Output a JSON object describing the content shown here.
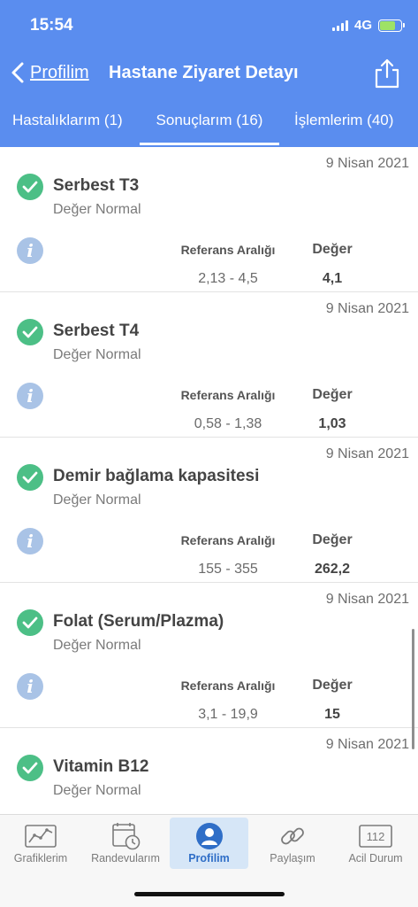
{
  "status_bar": {
    "time": "15:54",
    "network": "4G"
  },
  "nav": {
    "back_label": "Profilim",
    "title": "Hastane Ziyaret Detayı"
  },
  "tabs": [
    {
      "label": "Hastalıklarım (1)"
    },
    {
      "label": "Sonuçlarım (16)"
    },
    {
      "label": "İşlemlerim (40)"
    }
  ],
  "results": [
    {
      "date": "9 Nisan 2021",
      "name": "Serbest T3",
      "status": "Değer Normal",
      "ref_label": "Referans Aralığı",
      "ref": "2,13 - 4,5",
      "value_label": "Değer",
      "value": "4,1"
    },
    {
      "date": "9 Nisan 2021",
      "name": "Serbest T4",
      "status": "Değer Normal",
      "ref_label": "Referans Aralığı",
      "ref": "0,58 - 1,38",
      "value_label": "Değer",
      "value": "1,03"
    },
    {
      "date": "9 Nisan 2021",
      "name": "Demir bağlama kapasitesi",
      "status": "Değer Normal",
      "ref_label": "Referans Aralığı",
      "ref": "155 - 355",
      "value_label": "Değer",
      "value": "262,2"
    },
    {
      "date": "9 Nisan 2021",
      "name": "Folat (Serum/Plazma)",
      "status": "Değer Normal",
      "ref_label": "Referans Aralığı",
      "ref": "3,1 - 19,9",
      "value_label": "Değer",
      "value": "15"
    },
    {
      "date": "9 Nisan 2021",
      "name": "Vitamin B12",
      "status": "Değer Normal"
    }
  ],
  "tabbar": [
    {
      "label": "Grafiklerim",
      "icon": "chart-icon"
    },
    {
      "label": "Randevularım",
      "icon": "calendar-clock-icon"
    },
    {
      "label": "Profilim",
      "icon": "profile-icon"
    },
    {
      "label": "Paylaşım",
      "icon": "link-icon"
    },
    {
      "label": "Acil Durum",
      "icon": "emergency-112-icon",
      "badge": "112"
    }
  ],
  "colors": {
    "header": "#5a8def",
    "check": "#4cbf86",
    "info": "#a9c3e6",
    "active_tab_bg": "#d6e6f7"
  }
}
